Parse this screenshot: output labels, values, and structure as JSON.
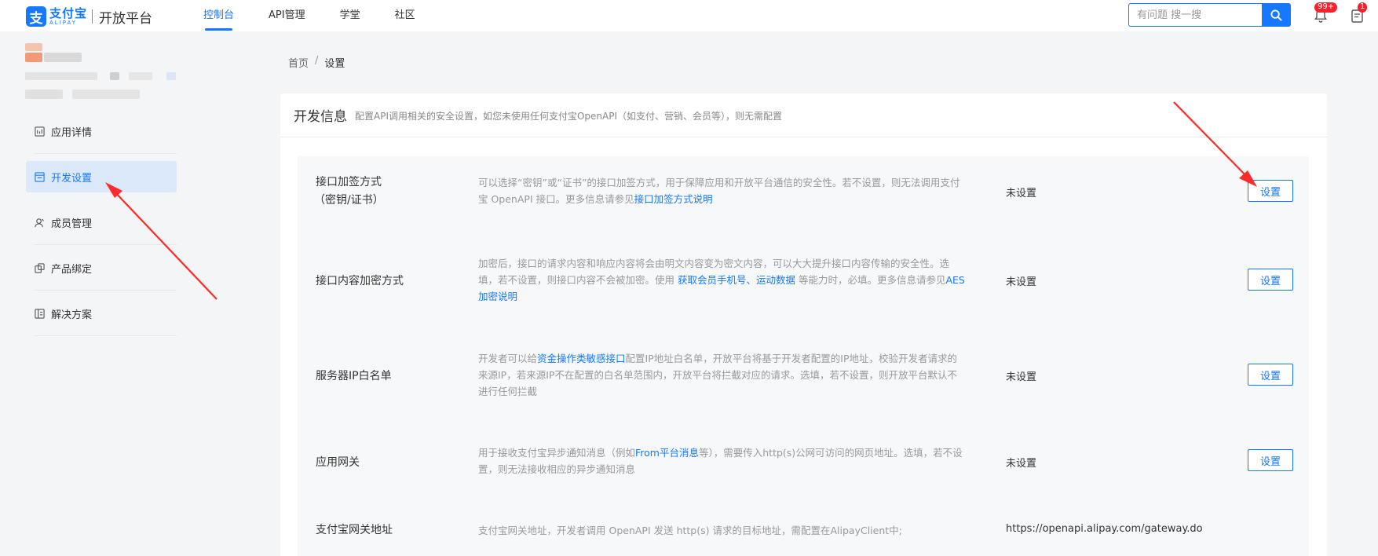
{
  "header": {
    "logo_cn": "支付宝",
    "logo_en": "ALIPAY",
    "logo_glyph": "支",
    "platform": "开放平台",
    "nav": [
      {
        "label": "控制台",
        "active": true
      },
      {
        "label": "API管理",
        "active": false
      },
      {
        "label": "学堂",
        "active": false
      },
      {
        "label": "社区",
        "active": false
      }
    ],
    "search_placeholder": "有问题 搜一搜",
    "notification_badge": "99+",
    "todo_badge": "1"
  },
  "sidebar": {
    "items": [
      {
        "label": "应用详情",
        "icon": "app-detail-icon",
        "active": false
      },
      {
        "label": "开发设置",
        "icon": "dev-settings-icon",
        "active": true
      },
      {
        "label": "成员管理",
        "icon": "members-icon",
        "active": false
      },
      {
        "label": "产品绑定",
        "icon": "product-bind-icon",
        "active": false
      },
      {
        "label": "解决方案",
        "icon": "solutions-icon",
        "active": false
      }
    ]
  },
  "breadcrumb": {
    "home": "首页",
    "separator": "/",
    "current": "设置"
  },
  "card": {
    "title": "开发信息",
    "description": "配置API调用相关的安全设置，如您未使用任何支付宝OpenAPI（如支付、营销、会员等），则无需配置"
  },
  "rows": [
    {
      "label_line1": "接口加签方式",
      "label_line2": "（密钥/证书）",
      "desc_parts": [
        {
          "t": "可以选择"
        },
        {
          "t": "“密钥”或“证书”的接口加签方式，用于保障应用和开放平台通信的安全性。若不设置，则无法调用支付宝 OpenAPI 接口。更多信息请参见"
        },
        {
          "t": "接口加签方式说明",
          "link": true
        }
      ],
      "value": "未设置",
      "button": "设置"
    },
    {
      "label_line1": "接口内容加密方式",
      "desc_parts": [
        {
          "t": "加密后，接口的请求内容和响应内容将会由明文内容变为密文内容，可以大大提升接口内容传输的安全性。选填，若不设置，则接口内容不会被加密。使用 "
        },
        {
          "t": "获取会员手机号、运动数据",
          "link": true
        },
        {
          "t": " 等能力时，必填。更多信息请参见"
        },
        {
          "t": "AES加密说明",
          "link": true
        }
      ],
      "value": "未设置",
      "button": "设置"
    },
    {
      "label_line1": "服务器IP白名单",
      "desc_parts": [
        {
          "t": "开发者可以给"
        },
        {
          "t": "资金操作类敏感接口",
          "link": true
        },
        {
          "t": "配置IP地址白名单，开放平台将基于开发者配置的IP地址，校验开发者请求的来源IP，若来源IP不在配置的白名单范围内，开放平台将拦截对应的请求。选填，若不设置，则开放平台默认不进行任何拦截"
        }
      ],
      "value": "未设置",
      "button": "设置"
    },
    {
      "label_line1": "应用网关",
      "desc_parts": [
        {
          "t": "用于接收支付宝异步通知消息（例如"
        },
        {
          "t": "From平台消息",
          "link": true
        },
        {
          "t": "等），需要传入http(s)公网可访问的网页地址。选填，若不设置，则无法接收相应的异步通知消息"
        }
      ],
      "value": "未设置",
      "button": "设置"
    },
    {
      "label_line1": "支付宝网关地址",
      "desc_parts": [
        {
          "t": "支付宝网关地址，开发者调用 OpenAPI 发送 http(s) 请求的目标地址，需配置在AlipayClient中;"
        }
      ],
      "value": "https://openapi.alipay.com/gateway.do"
    }
  ],
  "colors": {
    "accent": "#1677ff",
    "badge": "#f5222d",
    "arrow": "#ff2a2a",
    "active_bg": "#dce9fb"
  }
}
